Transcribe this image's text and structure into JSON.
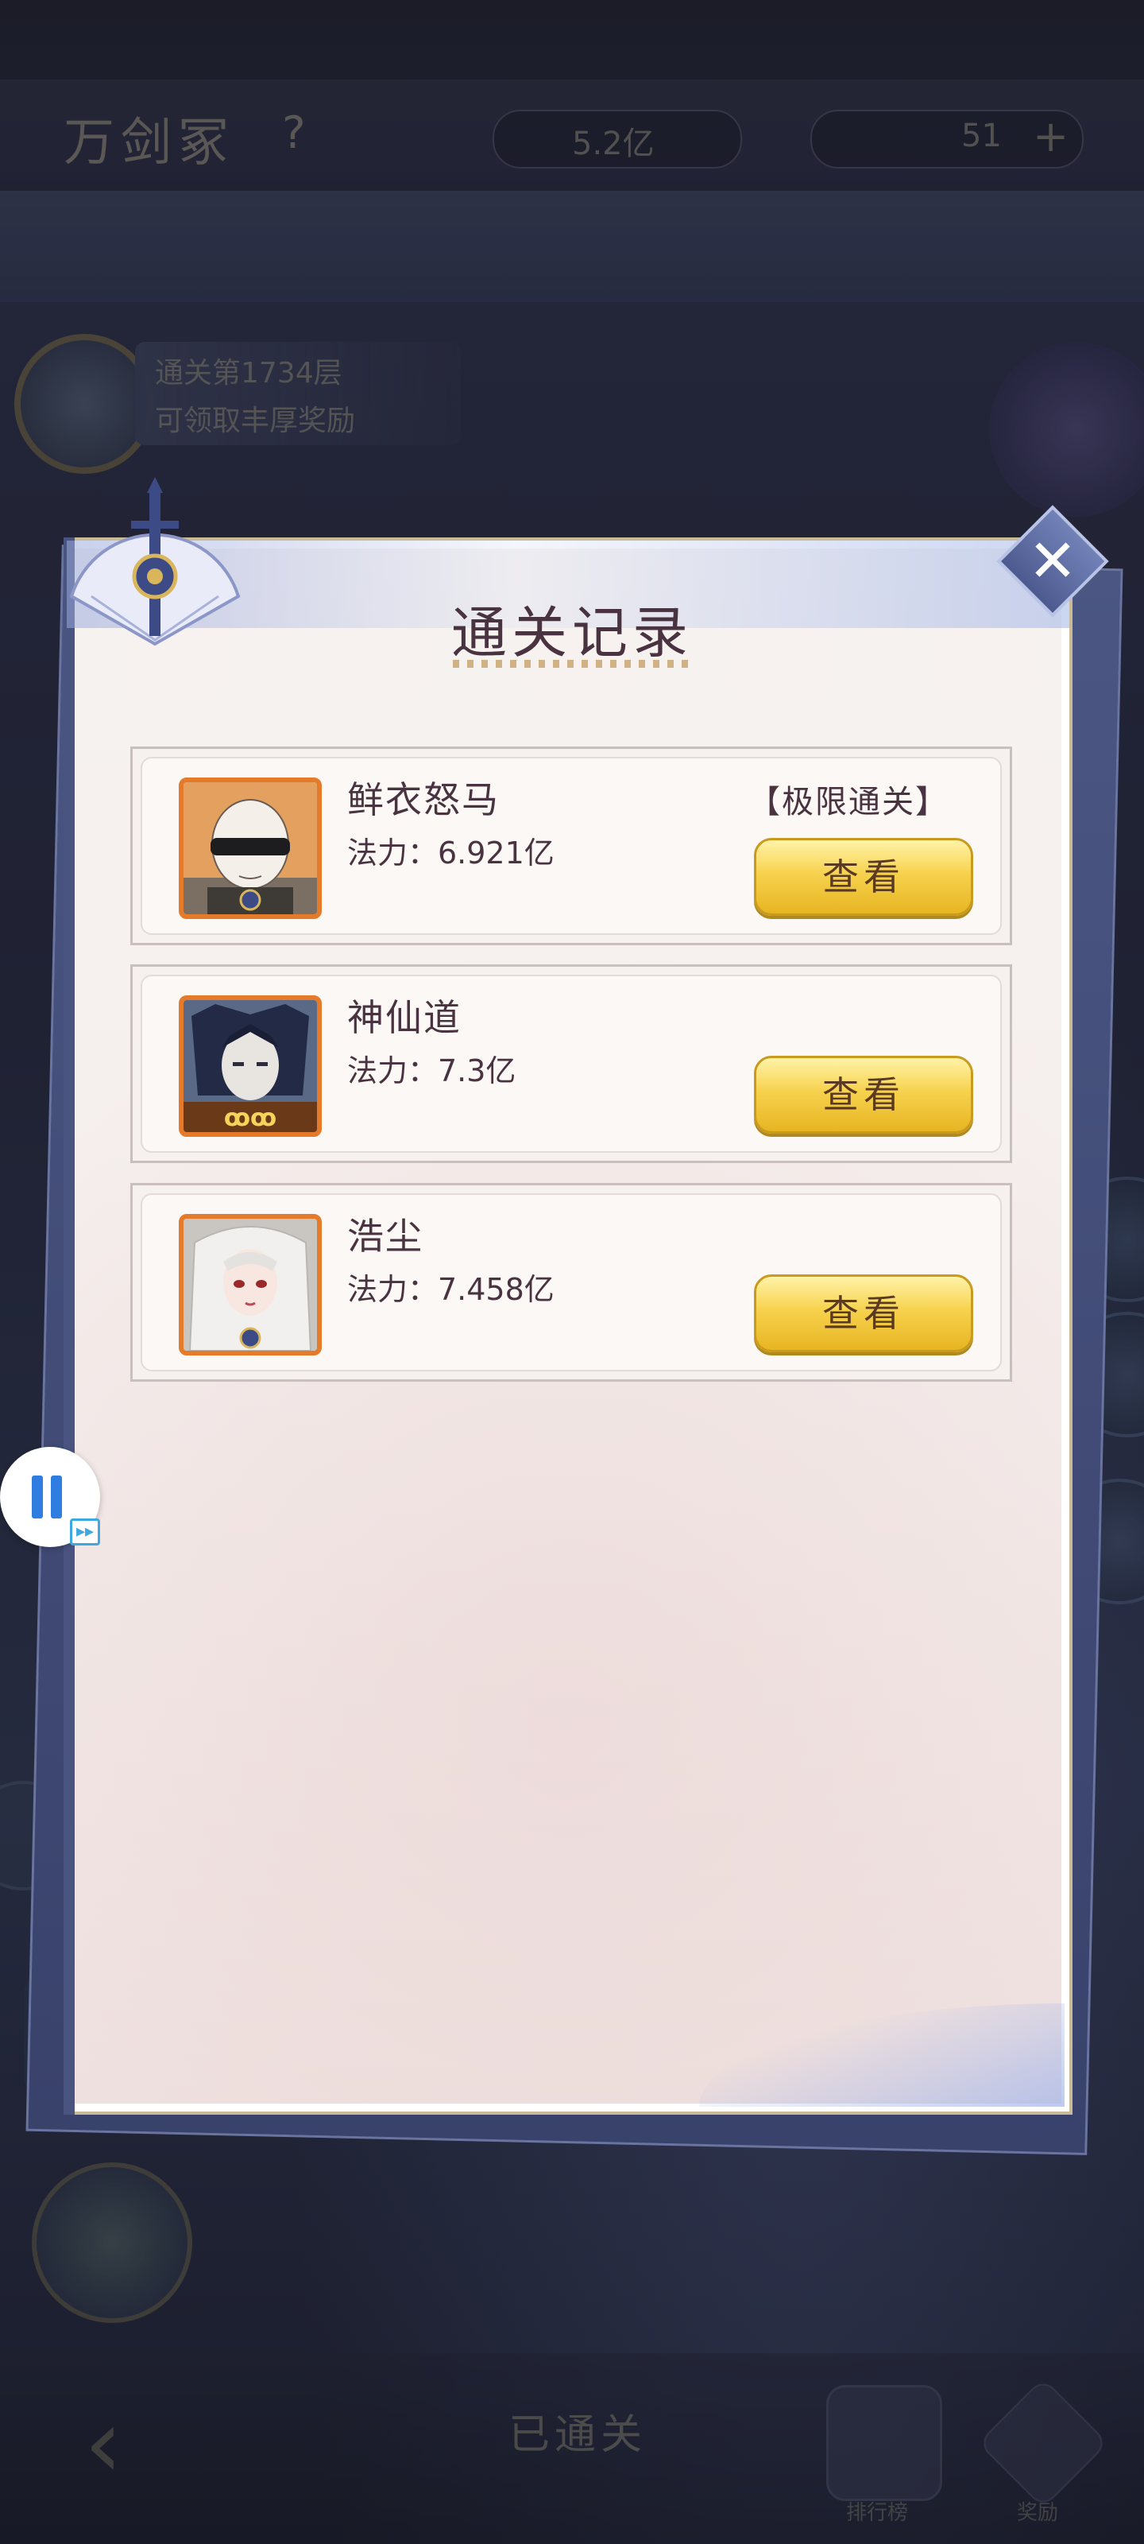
{
  "background": {
    "title": "万剑冢",
    "help": "?",
    "resource_1": "5.2亿",
    "resource_2": "51",
    "plus": "+",
    "banner_line_1": "通关第1734层",
    "banner_line_2": "可领取丰厚奖励",
    "bottom_title": "已通关",
    "bottom_btn_1_label": "排行榜",
    "bottom_btn_2_label": "奖励"
  },
  "dialog": {
    "title": "通关记录",
    "close_symbol": "✕",
    "records": [
      {
        "name": "鲜衣怒马",
        "power": "法力：6.921亿",
        "tag": "【极限通关】",
        "view_label": "查看",
        "avatar": "bald-blindfold-avatar"
      },
      {
        "name": "神仙道",
        "power": "法力：7.3亿",
        "tag": "",
        "view_label": "查看",
        "avatar": "dark-haired-avatar"
      },
      {
        "name": "浩尘",
        "power": "法力：7.458亿",
        "tag": "",
        "view_label": "查看",
        "avatar": "white-haired-avatar"
      }
    ]
  },
  "overlay": {
    "pause_icon": "pause-icon",
    "fast_forward_icon": "fast-forward-icon",
    "fast_forward_symbol": "▸▸"
  },
  "colors": {
    "dialog_bg": "#f6f0ee",
    "title_text": "#4a3340",
    "button_gold": "#f7d24e",
    "avatar_border": "#e57b2a",
    "accent_blue": "#4d5a8f"
  }
}
